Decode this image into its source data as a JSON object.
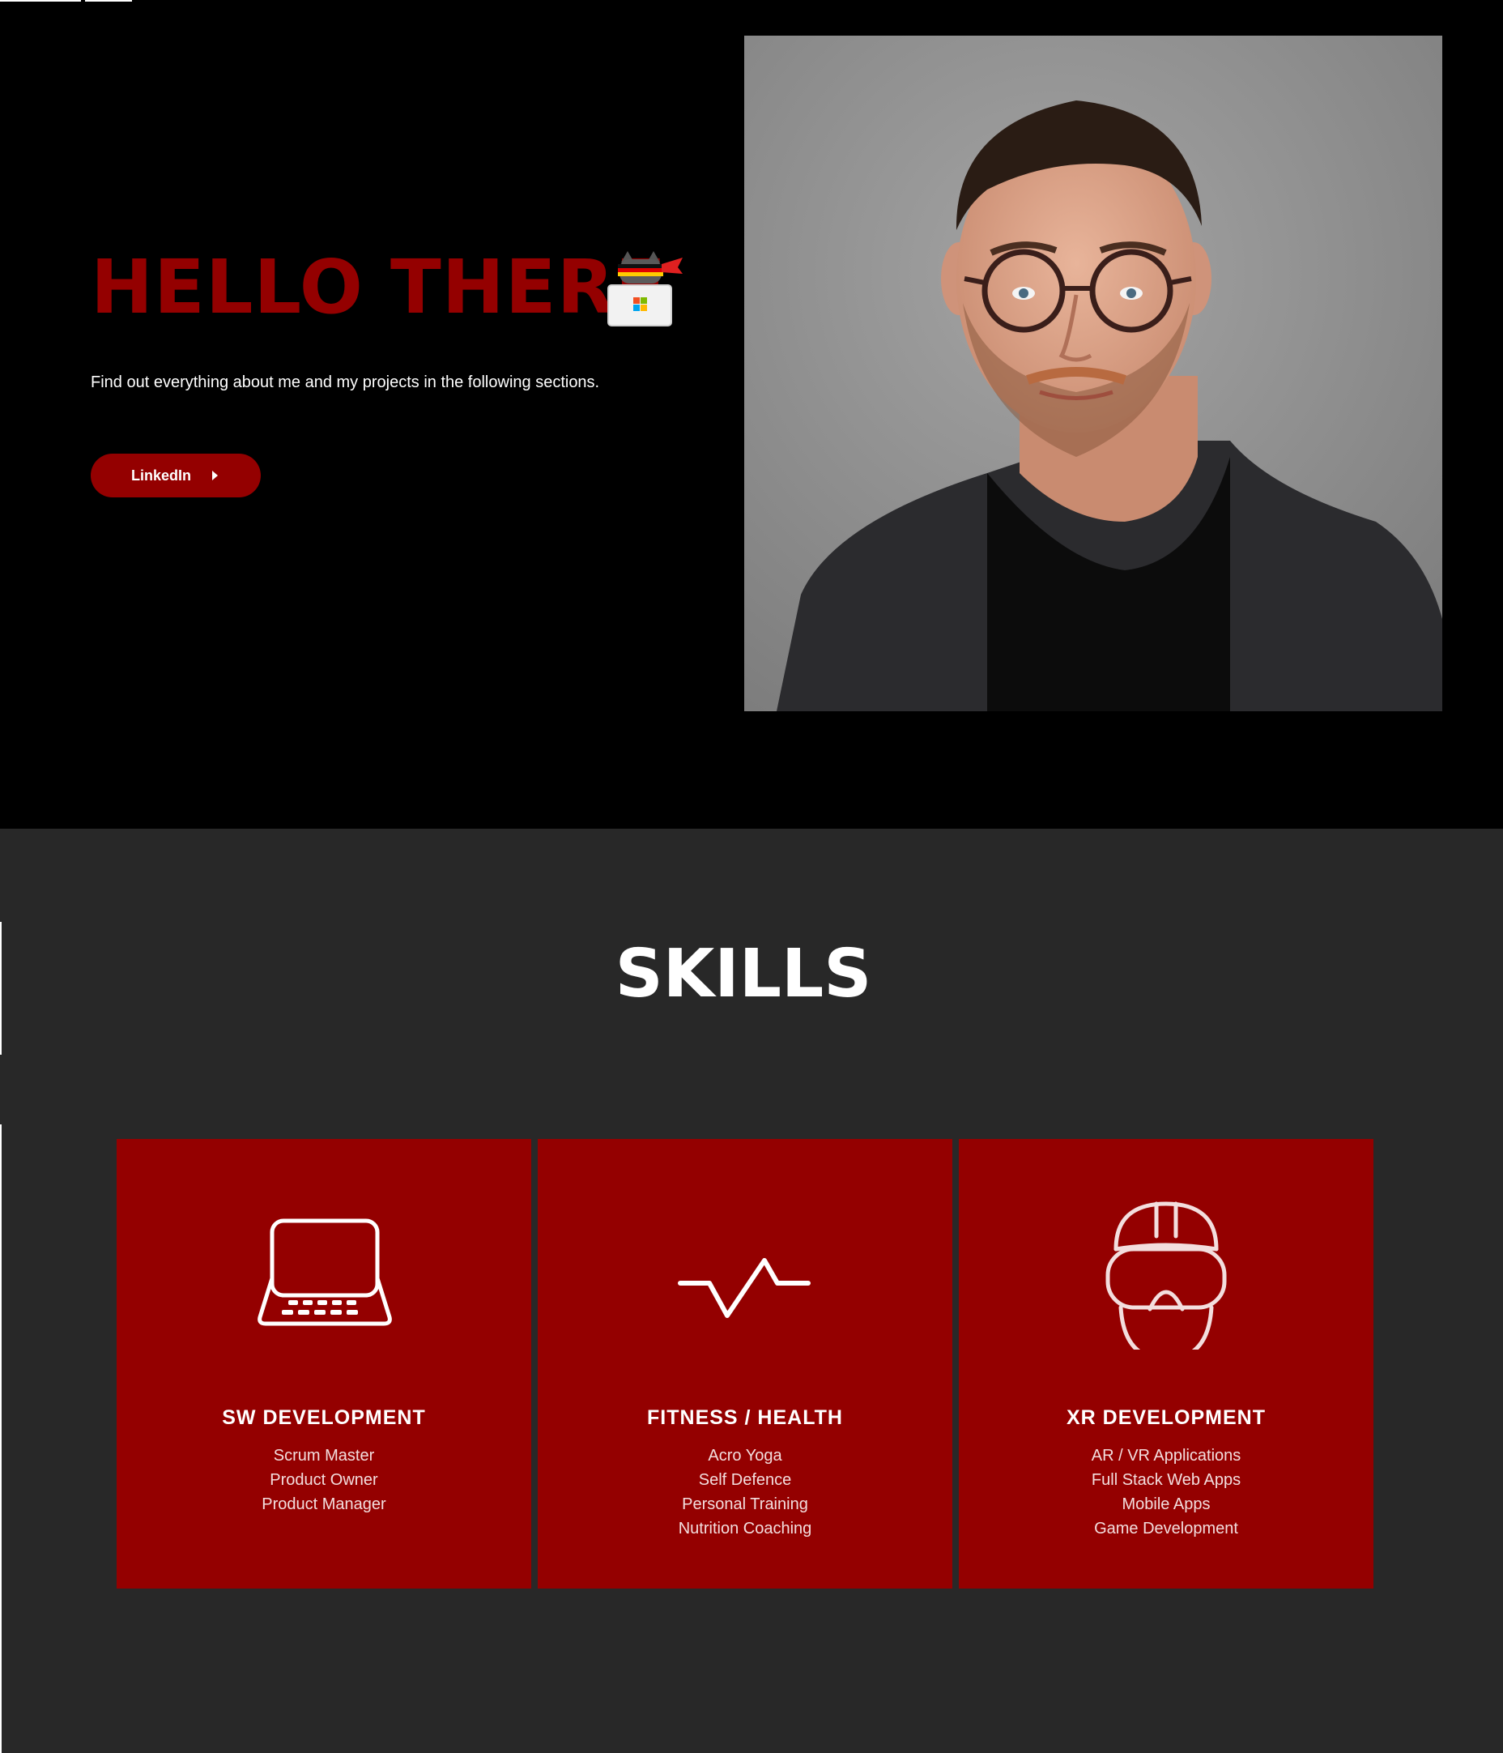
{
  "theme": {
    "accent": "#940000",
    "hero_bg": "#000000",
    "skills_bg": "#282828",
    "text": "#ffffff"
  },
  "hero": {
    "title": "HELLO THERE",
    "badge_icon": "ninja-cat-microsoft-icon",
    "subtitle": "Find out everything about me and my projects in the following sections.",
    "button_label": "LinkedIn",
    "button_icon": "caret-right-icon",
    "portrait_icon": "portrait-photo"
  },
  "skills": {
    "title": "SKILLS",
    "cards": [
      {
        "icon": "laptop-icon",
        "title": "SW DEVELOPMENT",
        "items": [
          "Scrum Master",
          "Product Owner",
          "Product Manager"
        ]
      },
      {
        "icon": "heartbeat-icon",
        "title": "FITNESS / HEALTH",
        "items": [
          "Acro Yoga",
          "Self Defence",
          "Personal Training",
          "Nutrition Coaching"
        ]
      },
      {
        "icon": "vr-headset-icon",
        "title": "XR DEVELOPMENT",
        "items": [
          "AR / VR Applications",
          "Full Stack Web Apps",
          "Mobile Apps",
          "Game Development"
        ]
      }
    ]
  }
}
